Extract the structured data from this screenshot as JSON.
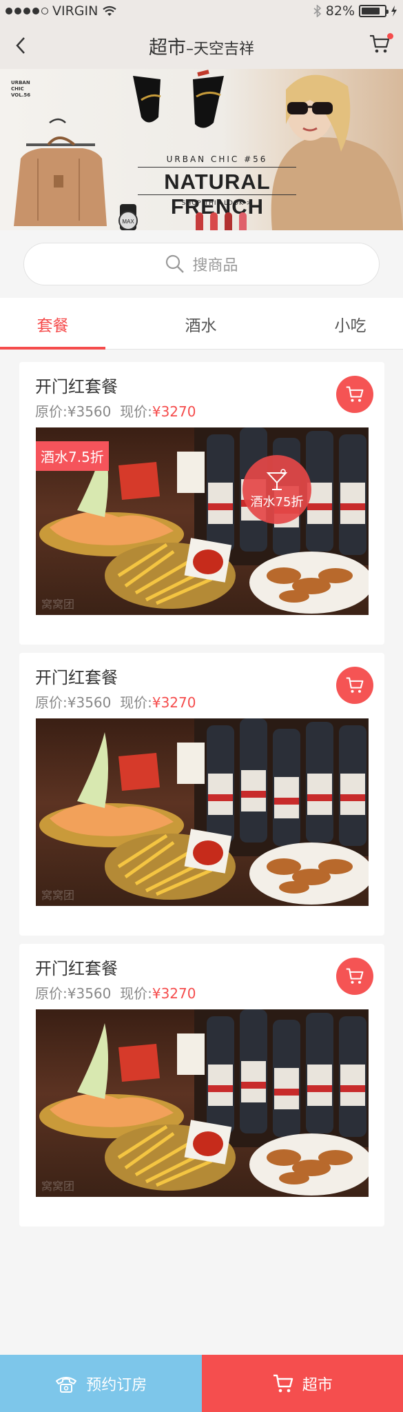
{
  "status_bar": {
    "carrier": "VIRGIN",
    "battery": "82%",
    "battery_level": 0.82
  },
  "nav": {
    "title": "超市",
    "subtitle": "–天空吉祥"
  },
  "banner": {
    "vol": "URBAN CHIC VOL.56",
    "vol_line1": "URBAN",
    "vol_line2": "CHIC",
    "vol_line3": "VOL.56",
    "tag": "URBAN CHIC #56",
    "headline": "NATURAL FRENCH",
    "shop_link": "SHOP THIS LOOK >",
    "watch_brand": "MAX"
  },
  "search": {
    "placeholder": "搜商品"
  },
  "tabs": [
    {
      "label": "套餐",
      "active": true
    },
    {
      "label": "酒水",
      "active": false
    },
    {
      "label": "小吃",
      "active": false
    }
  ],
  "cards": [
    {
      "title": "开门红套餐",
      "original_label": "原价:",
      "original_price": "¥3560",
      "current_label": "现价:",
      "current_price": "¥3270",
      "badge_rect": "酒水7.5折",
      "badge_circle": "酒水75折",
      "watermark": "窝窝团"
    },
    {
      "title": "开门红套餐",
      "original_label": "原价:",
      "original_price": "¥3560",
      "current_label": "现价:",
      "current_price": "¥3270",
      "watermark": "窝窝团"
    },
    {
      "title": "开门红套餐",
      "original_label": "原价:",
      "original_price": "¥3560",
      "current_label": "现价:",
      "current_price": "¥3270",
      "watermark": "窝窝团"
    }
  ],
  "bottom_bar": {
    "book_label": "预约订房",
    "market_label": "超市"
  },
  "colors": {
    "accent": "#f54c4c",
    "book": "#7dc6ea",
    "nav_bg": "#ede9e6"
  }
}
